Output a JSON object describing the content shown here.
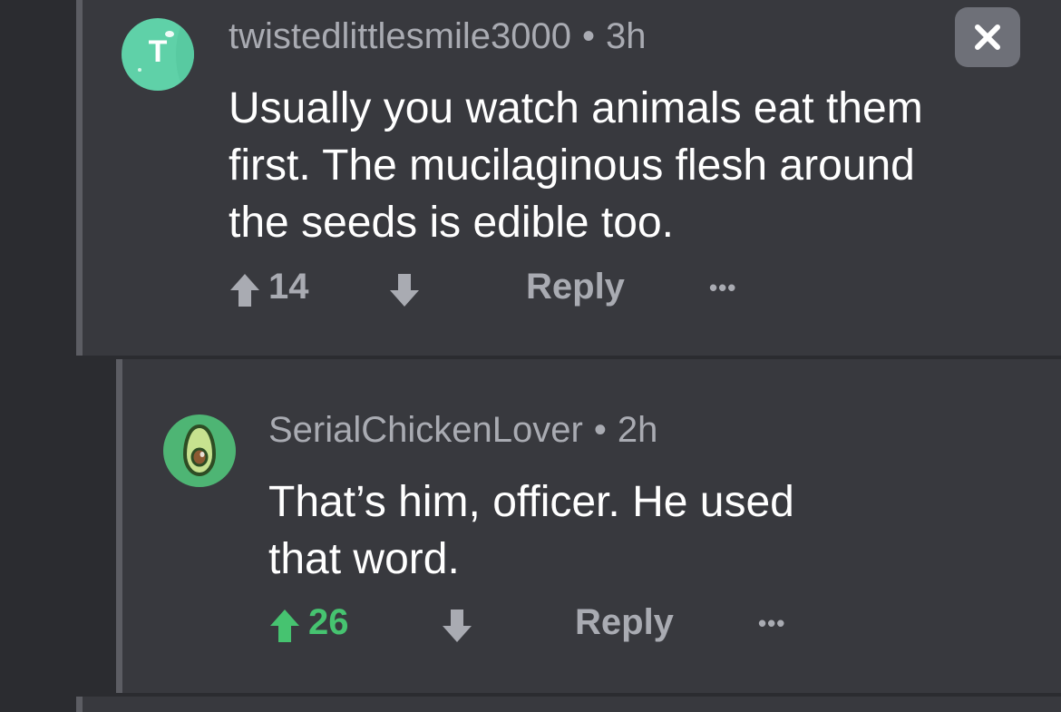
{
  "comments": [
    {
      "username": "twistedlittlesmile3000",
      "separator": "•",
      "age": "3h",
      "avatar_letter": "T",
      "body_lines": [
        "Usually you watch animals eat them",
        "first. The mucilaginous flesh around",
        "the seeds is edible too."
      ],
      "upvote_count": "14",
      "reply_label": "Reply",
      "more_label": "•••"
    },
    {
      "username": "SerialChickenLover",
      "separator": "•",
      "age": "2h",
      "body_lines": [
        "That’s him, officer. He used",
        "that word."
      ],
      "upvote_count": "26",
      "reply_label": "Reply",
      "more_label": "•••"
    }
  ],
  "colors": {
    "background": "#2b2c30",
    "panel": "#38393e",
    "thread_line": "#5c5d63",
    "muted_text": "#a9abb2",
    "upvoted_green": "#46c370",
    "avatar_teal": "#5fd1a8",
    "avatar_green": "#4eb574"
  },
  "icons": {
    "upvote": "arrow-up-icon",
    "downvote": "arrow-down-icon",
    "close": "close-icon",
    "avocado": "avocado-icon"
  }
}
